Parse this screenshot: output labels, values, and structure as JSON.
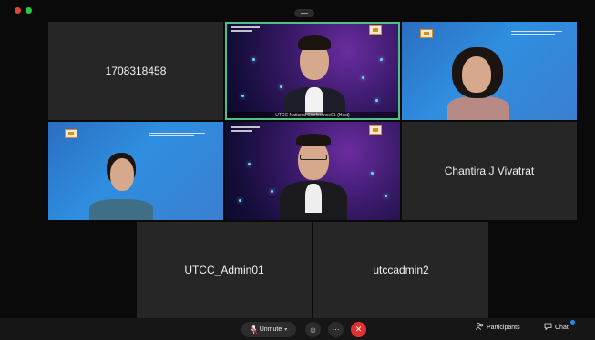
{
  "window": {
    "controls": [
      "close",
      "maximize"
    ]
  },
  "tiles": [
    {
      "id": "tile-1708318458",
      "name": "1708318458",
      "type": "name-only"
    },
    {
      "id": "tile-host",
      "name": "UTCC National Conference01 (Host)",
      "type": "camera",
      "active": true
    },
    {
      "id": "tile-woman-right",
      "name": "",
      "type": "camera"
    },
    {
      "id": "tile-woman-left",
      "name": "",
      "type": "camera"
    },
    {
      "id": "tile-man-glasses",
      "name": "",
      "type": "camera"
    },
    {
      "id": "tile-chantira",
      "name": "Chantira J Vivatrat",
      "type": "name-only"
    },
    {
      "id": "tile-utcc-admin01",
      "name": "UTCC_Admin01",
      "type": "name-only"
    },
    {
      "id": "tile-utccadmin2",
      "name": "utccadmin2",
      "type": "name-only"
    }
  ],
  "slide_text": {
    "line1": "สำนักงานเศรษฐกิจอุตสาหกรรม",
    "line2": "Office of Industrial Economics"
  },
  "toolbar": {
    "unmute_label": "Unmute",
    "participants_label": "Participants",
    "chat_label": "Chat"
  },
  "colors": {
    "active_speaker": "#4ec18a",
    "leave": "#e0312f",
    "notification": "#1f8cf0",
    "tile_bg": "#262626"
  },
  "icons": [
    "microphone-icon",
    "chevron-down-icon",
    "smile-icon",
    "more-icon",
    "close-icon",
    "participants-icon",
    "chat-icon"
  ]
}
